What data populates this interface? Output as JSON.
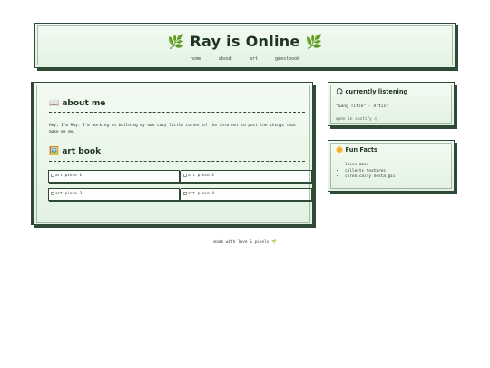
{
  "header": {
    "leaf_left": "🌿",
    "title": "Ray is Online",
    "leaf_right": "🌿",
    "nav": [
      "home",
      "about",
      "art",
      "guestbook"
    ]
  },
  "about": {
    "icon": "📖",
    "heading": "about me",
    "text": "Hey, I'm Ray. I'm working on building my own cozy little corner of the internet to post the things that make me me."
  },
  "art": {
    "icon": "🖼️",
    "heading": "art book",
    "items": [
      "art piece 1",
      "art piece 2",
      "art piece 3",
      "art piece 4"
    ]
  },
  "listening": {
    "icon": "🎧",
    "heading": "currently listening",
    "song": "\"Song Title\" - Artist",
    "link": "open in spotify ♫"
  },
  "facts": {
    "icon": "🌼",
    "heading": "Fun Facts",
    "items": [
      "loves moss",
      "collects textures",
      "chronically nostalgic"
    ]
  },
  "footer": {
    "text": "made with love & pixels 🌱"
  }
}
